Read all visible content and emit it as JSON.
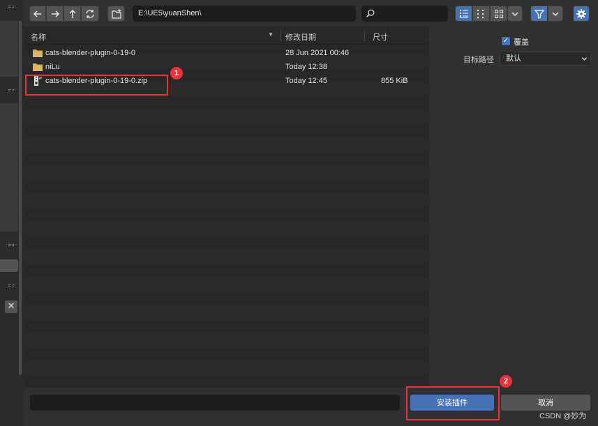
{
  "toolbar": {
    "path": "E:\\UE5\\yuanShen\\",
    "search_placeholder": ""
  },
  "columns": {
    "name": "名称",
    "modified": "修改日期",
    "size": "尺寸"
  },
  "files": [
    {
      "name": "cats-blender-plugin-0-19-0",
      "date": "28 Jun 2021 00:46",
      "size": "",
      "type": "folder"
    },
    {
      "name": "niLu",
      "date": "Today 12:38",
      "size": "",
      "type": "folder"
    },
    {
      "name": "cats-blender-plugin-0-19-0.zip",
      "date": "Today 12:45",
      "size": "855 KiB",
      "type": "zip"
    }
  ],
  "options": {
    "overwrite_label": "覆盖",
    "overwrite_checked": true,
    "target_label": "目标路径",
    "target_value": "默认"
  },
  "bottom": {
    "filename_value": "",
    "install_label": "安装插件",
    "cancel_label": "取消"
  },
  "annotations": {
    "badge1": "1",
    "badge2": "2",
    "color": "#e8333a"
  },
  "watermark": "CSDN @妙为",
  "colors": {
    "accent": "#4772b3",
    "panel": "#303030",
    "list_bg": "#2b2b2b"
  }
}
